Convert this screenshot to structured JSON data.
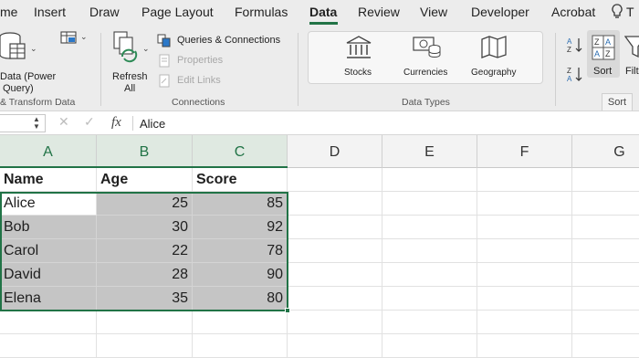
{
  "tabs": [
    {
      "label": "me",
      "active": false
    },
    {
      "label": "Insert",
      "active": false
    },
    {
      "label": "Draw",
      "active": false
    },
    {
      "label": "Page Layout",
      "active": false
    },
    {
      "label": "Formulas",
      "active": false
    },
    {
      "label": "Data",
      "active": true
    },
    {
      "label": "Review",
      "active": false
    },
    {
      "label": "View",
      "active": false
    },
    {
      "label": "Developer",
      "active": false
    },
    {
      "label": "Acrobat",
      "active": false
    },
    {
      "label": "T",
      "active": false
    }
  ],
  "ribbon": {
    "get_data": {
      "line1": "Data (Power",
      "line2": "Query)"
    },
    "get_transform_label": "& Transform Data",
    "refresh": {
      "line1": "Refresh",
      "line2": "All"
    },
    "queries_connections": "Queries & Connections",
    "properties": "Properties",
    "edit_links": "Edit Links",
    "connections_label": "Connections",
    "data_types": {
      "stocks": "Stocks",
      "currencies": "Currencies",
      "geography": "Geography",
      "label": "Data Types"
    },
    "sort": "Sort",
    "filter": "Filt",
    "sort_tooltip": "Sort"
  },
  "formula_bar": {
    "fx": "fx",
    "value": "Alice"
  },
  "grid": {
    "columns": [
      "A",
      "B",
      "C",
      "D",
      "E",
      "F",
      "G"
    ],
    "header_row": [
      "Name",
      "Age",
      "Score"
    ],
    "rows": [
      [
        "Alice",
        "25",
        "85"
      ],
      [
        "Bob",
        "30",
        "92"
      ],
      [
        "Carol",
        "22",
        "78"
      ],
      [
        "David",
        "28",
        "90"
      ],
      [
        "Elena",
        "35",
        "80"
      ]
    ]
  },
  "colors": {
    "accent": "#217346",
    "selection_fill": "#c5c5c5",
    "ribbon_bg": "#ececec"
  }
}
